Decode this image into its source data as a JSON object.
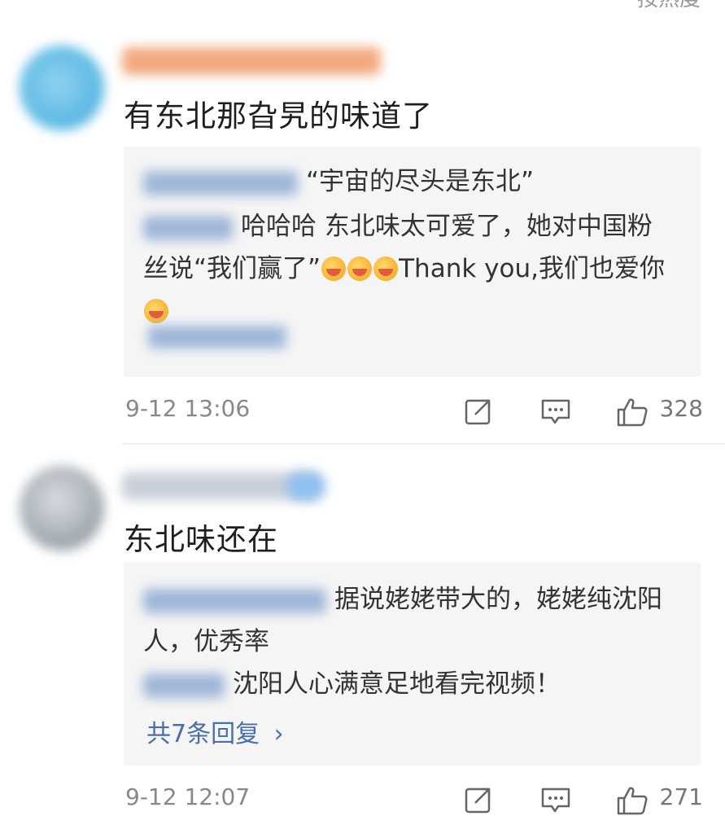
{
  "header": {
    "sort_label": "按热度"
  },
  "comments": [
    {
      "text": "有东北那旮旯的味道了",
      "replies": [
        {
          "text": "“宇宙的尽头是东北”"
        },
        {
          "text_a": "哈哈哈 东北味太可爱了，她对中国粉",
          "text_b": "丝说“我们赢了”",
          "text_c": "Thank you,我们也爱你"
        }
      ],
      "time": "9-12 13:06",
      "likes": "328"
    },
    {
      "text": "东北味还在",
      "replies": [
        {
          "text_a": "据说姥姥带大的，姥姥纯沈阳",
          "text_b": "人，优秀率"
        },
        {
          "text": "沈阳人心满意足地看完视频！"
        }
      ],
      "more_replies": "共7条回复",
      "time": "9-12 12:07",
      "likes": "271"
    }
  ],
  "icons": {
    "share": "share-icon",
    "comment": "comment-icon",
    "like": "like-icon"
  },
  "colors": {
    "link": "#4a6ea9",
    "reply_bg": "#f5f5f5"
  }
}
